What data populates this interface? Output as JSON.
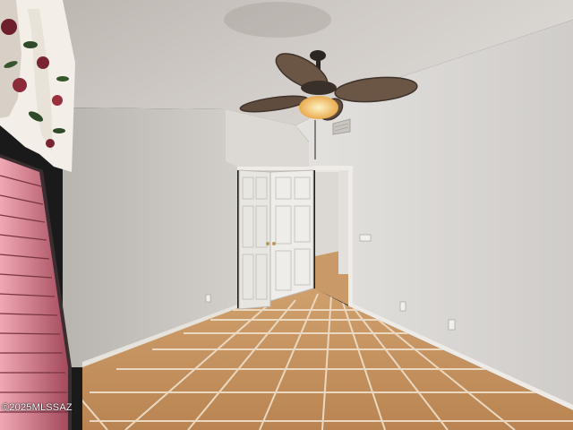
{
  "photo": {
    "watermark": "©2025MLSSAZ",
    "colors": {
      "ceiling": "#cfcac5",
      "wall_right": "#d9d6d3",
      "wall_left": "#cac7c3",
      "wall_back": "#d4d0cb",
      "floor_tile": "#c4915e",
      "grout": "#e8d6bf",
      "door": "#e6e4df",
      "fan_blade": "#6b5646",
      "fan_light": "#f5c870",
      "blinds": "#d77a8a"
    }
  }
}
